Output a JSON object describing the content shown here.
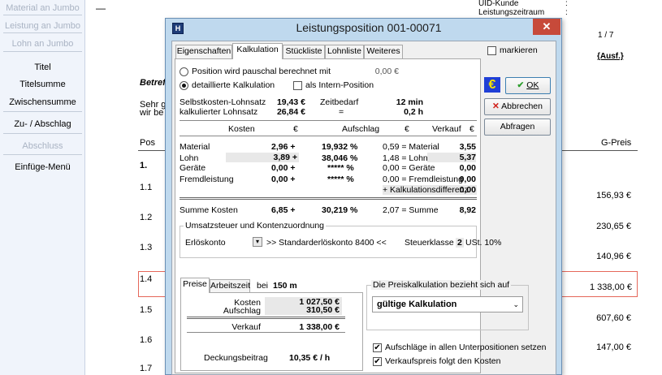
{
  "sidebar": {
    "items": [
      {
        "label": "Material an Jumbo",
        "enabled": false
      },
      {
        "label": "Leistung an Jumbo",
        "enabled": false
      },
      {
        "label": "Lohn an Jumbo",
        "enabled": false
      },
      {
        "label": "Titel",
        "enabled": true
      },
      {
        "label": "Titelsumme",
        "enabled": true
      },
      {
        "label": "Zwischensumme",
        "enabled": true
      },
      {
        "label": "Zu- / Abschlag",
        "enabled": true
      },
      {
        "label": "Abschluss",
        "enabled": false
      },
      {
        "label": "Einfüge-Menü",
        "enabled": true
      }
    ]
  },
  "document": {
    "header_uid": "UID-Kunde",
    "header_period": "Leistungszeitraum",
    "header_colon1": ":",
    "header_colon2": ":",
    "page": "1 / 7",
    "ausf": "{Ausf.}",
    "betreff": "Betref",
    "greeting1": "Sehr g",
    "greeting2": "wir be",
    "col_pos": "Pos",
    "col_gpreis": "G-Preis",
    "dash": "—",
    "rows": [
      {
        "pos": "1.",
        "price": ""
      },
      {
        "pos": "1.1",
        "price": "156,93 €"
      },
      {
        "pos": "1.2",
        "price": "230,65 €"
      },
      {
        "pos": "1.3",
        "price": "140,96 €"
      },
      {
        "pos": "1.4",
        "price": "1 338,00 €"
      },
      {
        "pos": "1.5",
        "price": "607,60 €"
      },
      {
        "pos": "1.6",
        "price": "147,00 €"
      },
      {
        "pos": "1.7",
        "price": ""
      }
    ]
  },
  "dialog": {
    "title": "Leistungsposition 001-00071",
    "icon_letter": "H",
    "close_glyph": "✕",
    "tabs": [
      "Eigenschaften",
      "Kalkulation",
      "Stückliste",
      "Lohnliste",
      "Weiteres"
    ],
    "selected_tab": "Kalkulation",
    "markieren_label": "markieren",
    "radio_pauschal": "Position wird pauschal berechnet mit",
    "pauschal_value": "0,00 €",
    "radio_detailliert": "detaillierte Kalkulation",
    "intern_label": "als Intern-Position",
    "euro_symbol": "€",
    "ok_label": "OK",
    "abbrechen_label": "Abbrechen",
    "abfragen_label": "Abfragen",
    "selbstkosten_label": "Selbstkosten-Lohnsatz",
    "selbstkosten_value": "19,43 €",
    "zeitbedarf_label": "Zeitbedarf",
    "zeitbedarf_value": "12 min",
    "kalk_lohnsatz_label": "kalkulierter Lohnsatz",
    "kalk_lohnsatz_value": "26,84 €",
    "equals": "=",
    "hours_value": "0,2 h",
    "table_headers": {
      "kosten": "Kosten",
      "euro1": "€",
      "aufschlag": "Aufschlag",
      "euro2": "€",
      "verkauf": "Verkauf",
      "euro3": "€"
    },
    "cost_rows": [
      {
        "label": "Material",
        "kosten": "2,96 +",
        "aufschlag": "19,932 %",
        "eur": "0,59 = Material",
        "verkauf": "3,55"
      },
      {
        "label": "Lohn",
        "kosten": "3,89 +",
        "aufschlag": "38,046 %",
        "eur": "1,48 = Lohn",
        "verkauf": "5,37"
      },
      {
        "label": "Geräte",
        "kosten": "0,00 +",
        "aufschlag": "***** %",
        "eur": "0,00 = Geräte",
        "verkauf": "0,00"
      },
      {
        "label": "Fremdleistung",
        "kosten": "0,00 +",
        "aufschlag": "***** %",
        "eur": "0,00 = Fremdleistung",
        "verkauf": "0,00"
      }
    ],
    "kalkdiff_label": "+ Kalkulationsdifferenz",
    "kalkdiff_value": "0,00",
    "summe_label": "Summe Kosten",
    "summe_kosten": "6,85 +",
    "summe_aufschlag": "30,219 %",
    "summe_eur": "2,07 = Summe",
    "summe_verkauf": "8,92",
    "ust_title": "Umsatzsteuer und Kontenzuordnung",
    "erloeskonto_label": "Erlöskonto",
    "erloeskonto_value": ">> Standarderlöskonto 8400 <<",
    "steuerklasse_label": "Steuerklasse",
    "steuerklasse_value": "2",
    "steuerklasse_text": "USt. 10%",
    "subtabs": [
      "Preise",
      "Arbeitszeit"
    ],
    "bei_label": "bei",
    "bei_value": "150 m",
    "kosten_label": "Kosten",
    "kosten_value": "1 027,50 €",
    "aufschlag_label": "Aufschlag",
    "aufschlag_value": "310,50 €",
    "verkauf_label": "Verkauf",
    "verkauf_value": "1 338,00 €",
    "deckung_label": "Deckungsbeitrag",
    "deckung_value": "10,35 € / h",
    "preiskalk_title": "Die Preiskalkulation bezieht sich auf",
    "preiskalk_value": "gültige Kalkulation",
    "aufschlaege_label": "Aufschläge in allen Unterpositionen setzen",
    "verkaufspreis_label": "Verkaufspreis folgt den Kosten",
    "check_glyph": "✔"
  },
  "colors": {
    "dialog_frame": "#bfd9ee",
    "close": "#c74a3a",
    "ok_check": "#2e9e2e",
    "abbrechen_x": "#d0201a",
    "euro_bg": "#1f3fd6",
    "euro_fg": "#f5e400",
    "highlight_row": "#e5675a"
  }
}
